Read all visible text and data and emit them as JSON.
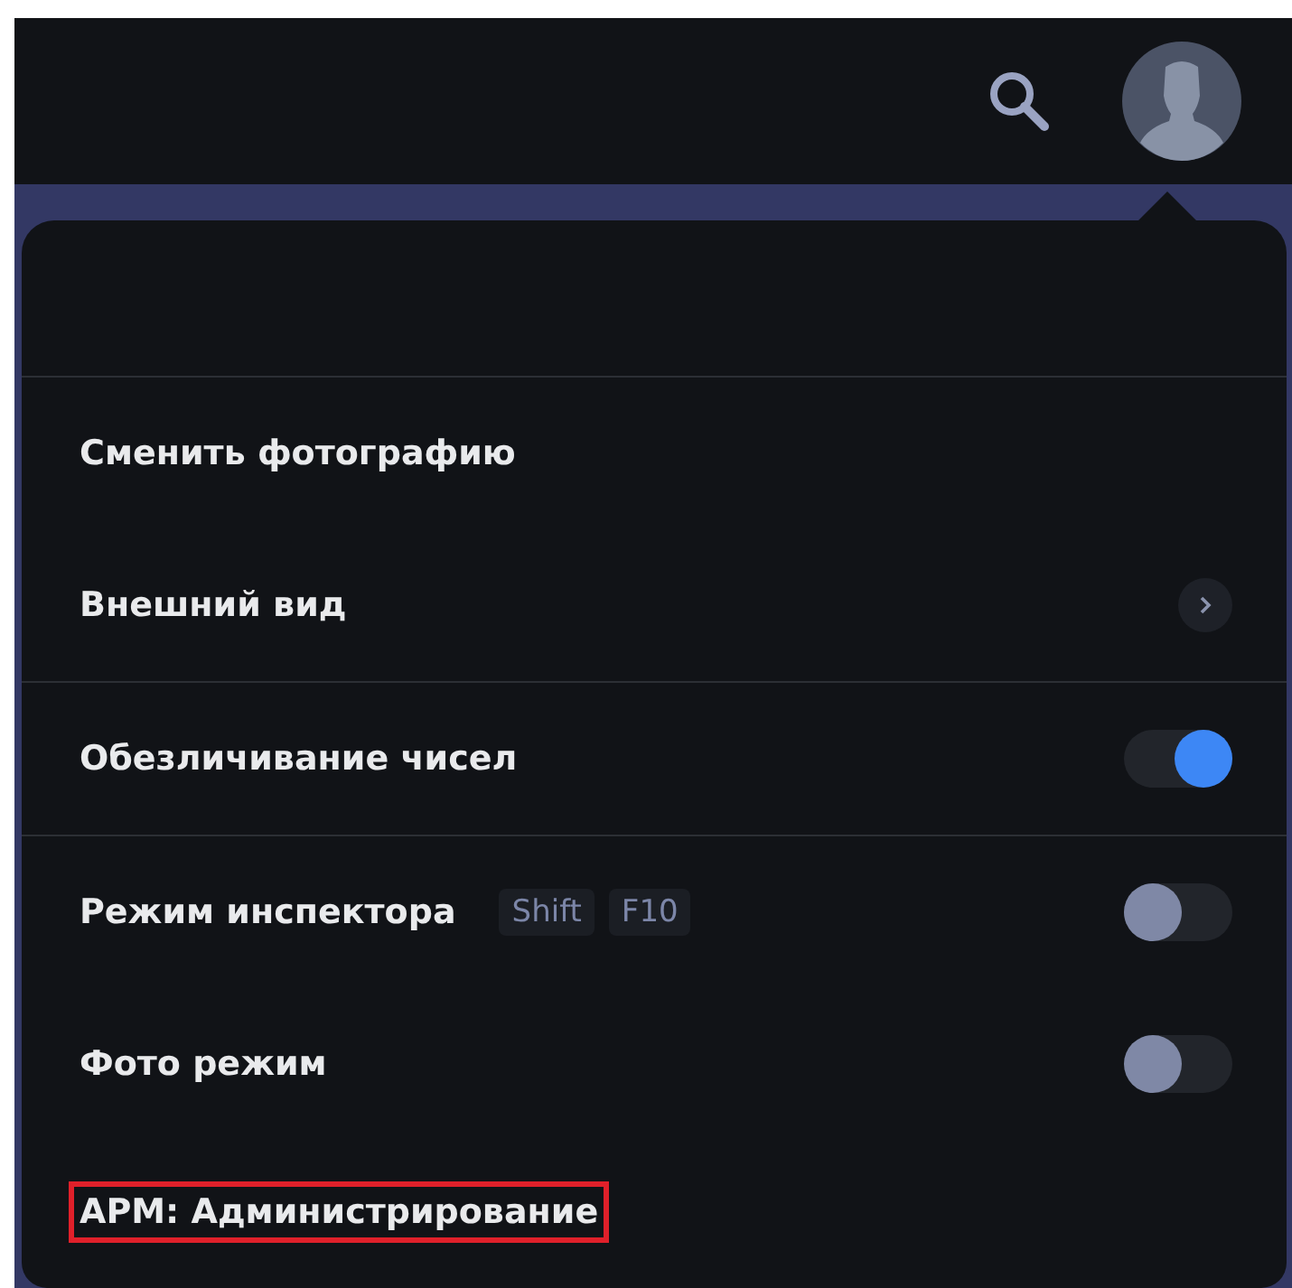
{
  "menu": {
    "items": [
      {
        "kind": "action",
        "label": "Сменить фотографию"
      },
      {
        "kind": "submenu",
        "label": "Внешний вид",
        "divider_after": true
      },
      {
        "kind": "toggle",
        "label": "Обезличивание чисел",
        "on": true,
        "divider_after": true
      },
      {
        "kind": "toggle",
        "label": "Режим инспектора",
        "on": false,
        "shortcut": [
          "Shift",
          "F10"
        ]
      },
      {
        "kind": "toggle",
        "label": "Фото режим",
        "on": false
      },
      {
        "kind": "action",
        "label": "АРМ: Администрирование",
        "highlighted": true
      }
    ]
  }
}
